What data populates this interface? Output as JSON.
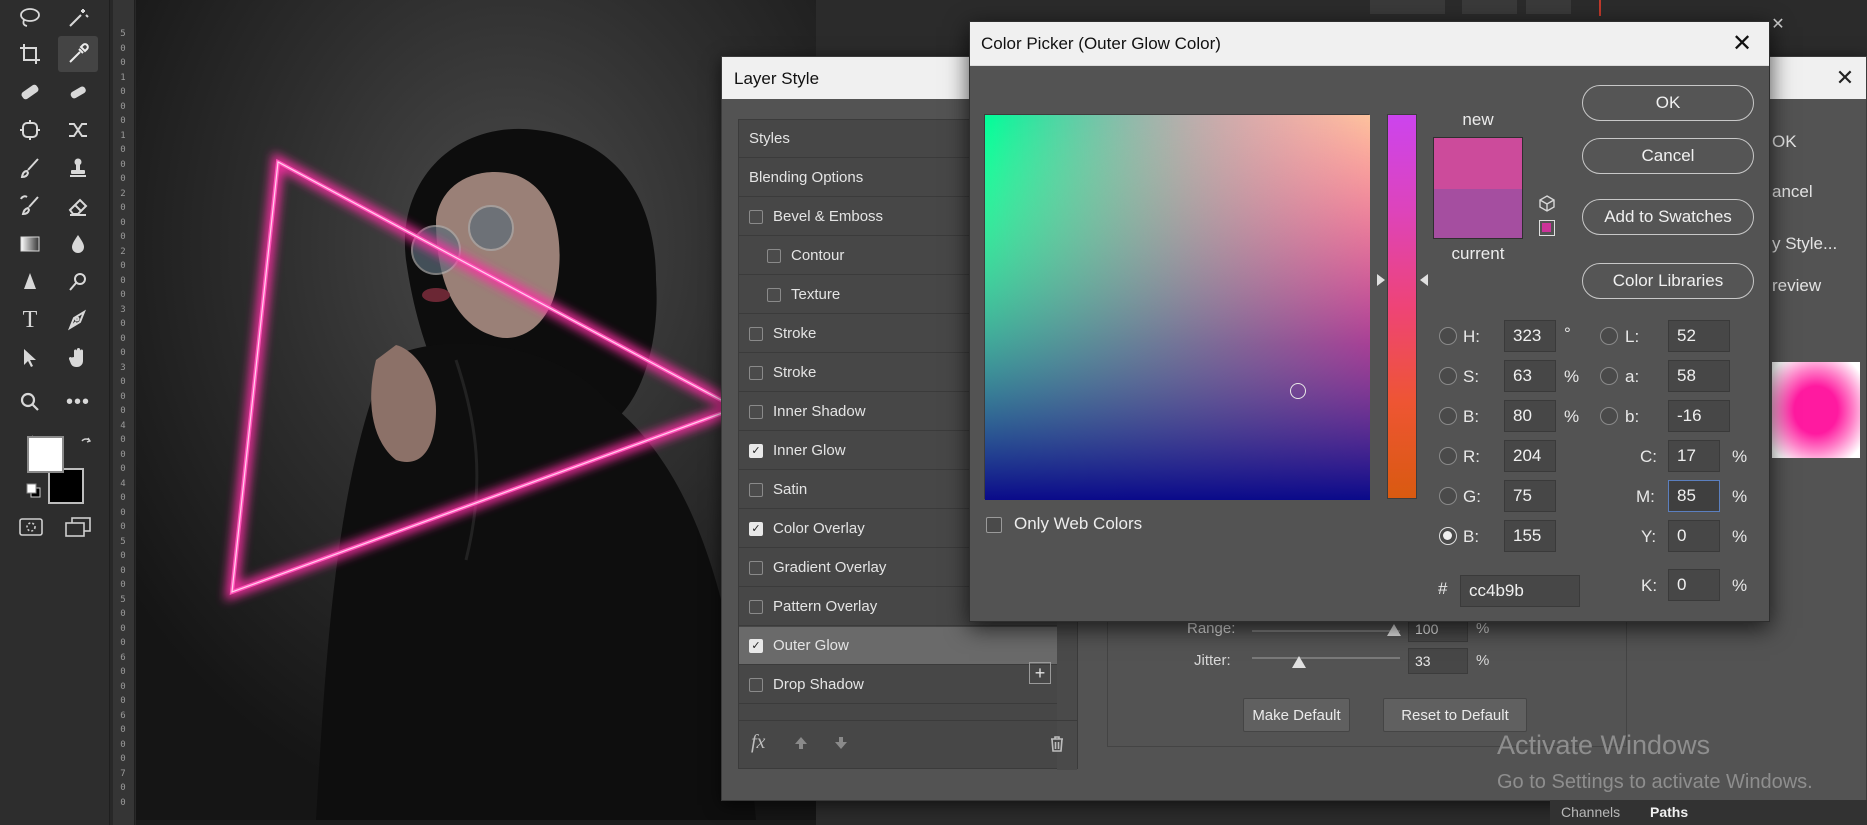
{
  "toolbar": {
    "tools": [
      "lasso-icon",
      "magic-wand-icon",
      "crop-icon",
      "eyedropper-icon",
      "spot-healing-icon",
      "patch-icon",
      "frame-icon",
      "content-aware-move-icon",
      "brush-icon",
      "clone-stamp-icon",
      "history-brush-icon",
      "eraser-icon",
      "gradient-icon",
      "blur-icon",
      "pen-icon",
      "dodge-icon",
      "type-icon",
      "path-selection-icon",
      "move-icon",
      "hand-icon",
      "zoom-icon",
      "more-icon"
    ]
  },
  "ruler": {
    "digits": [
      "5",
      "0",
      "0",
      "1",
      "0",
      "0",
      "0",
      "1",
      "0",
      "0",
      "0",
      "2",
      "0",
      "0",
      "0",
      "2",
      "0",
      "0",
      "0",
      "3",
      "0",
      "0",
      "0",
      "3",
      "0",
      "0",
      "0",
      "4",
      "0",
      "0",
      "0",
      "4",
      "0",
      "0",
      "0",
      "5",
      "0",
      "0",
      "0",
      "5",
      "0",
      "0",
      "0",
      "6",
      "0",
      "0",
      "0",
      "6",
      "0",
      "0",
      "0",
      "7",
      "0",
      "0"
    ]
  },
  "layer_style": {
    "title": "Layer Style",
    "items": [
      {
        "label": "Styles",
        "checkbox": false,
        "checked": false,
        "indent": false,
        "selected": false
      },
      {
        "label": "Blending Options",
        "checkbox": false,
        "checked": false,
        "indent": false,
        "selected": false
      },
      {
        "label": "Bevel & Emboss",
        "checkbox": true,
        "checked": false,
        "indent": false,
        "selected": false
      },
      {
        "label": "Contour",
        "checkbox": true,
        "checked": false,
        "indent": true,
        "selected": false
      },
      {
        "label": "Texture",
        "checkbox": true,
        "checked": false,
        "indent": true,
        "selected": false
      },
      {
        "label": "Stroke",
        "checkbox": true,
        "checked": false,
        "indent": false,
        "selected": false
      },
      {
        "label": "Stroke",
        "checkbox": true,
        "checked": false,
        "indent": false,
        "selected": false
      },
      {
        "label": "Inner Shadow",
        "checkbox": true,
        "checked": false,
        "indent": false,
        "selected": false
      },
      {
        "label": "Inner Glow",
        "checkbox": true,
        "checked": true,
        "indent": false,
        "selected": false
      },
      {
        "label": "Satin",
        "checkbox": true,
        "checked": false,
        "indent": false,
        "selected": false
      },
      {
        "label": "Color Overlay",
        "checkbox": true,
        "checked": true,
        "indent": false,
        "selected": false
      },
      {
        "label": "Gradient Overlay",
        "checkbox": true,
        "checked": false,
        "indent": false,
        "selected": false
      },
      {
        "label": "Pattern Overlay",
        "checkbox": true,
        "checked": false,
        "indent": false,
        "selected": false
      },
      {
        "label": "Outer Glow",
        "checkbox": true,
        "checked": true,
        "indent": false,
        "selected": true
      },
      {
        "label": "Drop Shadow",
        "checkbox": true,
        "checked": false,
        "indent": false,
        "selected": false
      }
    ],
    "fx_label": "fx",
    "range_label": "Range:",
    "range_value": "100",
    "jitter_label": "Jitter:",
    "jitter_value": "33",
    "percent": "%",
    "make_default": "Make Default",
    "reset_default": "Reset to Default",
    "right_buttons": [
      "OK",
      "ancel",
      "y Style...",
      "review"
    ]
  },
  "color_picker": {
    "title": "Color Picker (Outer Glow Color)",
    "new_label": "new",
    "current_label": "current",
    "new_color": "#cc4b9b",
    "current_color": "#a54ea0",
    "buttons": {
      "ok": "OK",
      "cancel": "Cancel",
      "add_swatches": "Add to Swatches",
      "libraries": "Color Libraries"
    },
    "hsb": {
      "h_label": "H:",
      "h": "323",
      "h_unit": "°",
      "s_label": "S:",
      "s": "63",
      "s_unit": "%",
      "b_label": "B:",
      "b": "80",
      "b_unit": "%"
    },
    "lab": {
      "l_label": "L:",
      "l": "52",
      "a_label": "a:",
      "a": "58",
      "b_label": "b:",
      "b": "-16"
    },
    "rgb": {
      "r_label": "R:",
      "r": "204",
      "g_label": "G:",
      "g": "75",
      "b_label": "B:",
      "b": "155"
    },
    "cmyk": {
      "c_label": "C:",
      "c": "17",
      "m_label": "M:",
      "m": "85",
      "y_label": "Y:",
      "y": "0",
      "k_label": "K:",
      "k": "0",
      "unit": "%"
    },
    "selected_mode": "B (RGB)",
    "hash": "#",
    "hex": "cc4b9b",
    "web_colors_label": "Only Web Colors"
  },
  "watermark": {
    "line1": "Activate Windows",
    "line2": "Go to Settings to activate Windows."
  },
  "bottom_tabs": [
    "Channels",
    "Paths"
  ],
  "colors": {
    "neon": "#ff2fa6",
    "foreground": "#ffffff",
    "background": "#000000"
  }
}
